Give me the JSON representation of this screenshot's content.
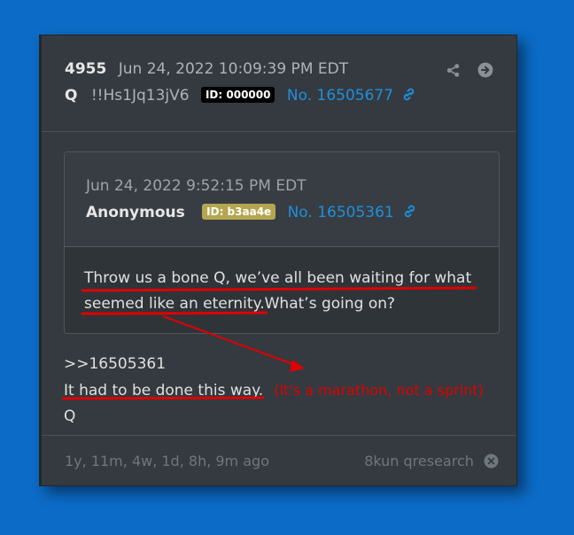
{
  "post": {
    "number": "4955",
    "date": "Jun 24, 2022 10:09:39 PM EDT",
    "author": "Q",
    "tripcode": "!!Hs1Jq13jV6",
    "id_badge": "ID: 000000",
    "post_no": "No. 16505677"
  },
  "quoted": {
    "date": "Jun 24, 2022 9:52:15 PM EDT",
    "author": "Anonymous",
    "id_badge": "ID: b3aa4e",
    "post_no": "No. 16505361",
    "body_line1": "Throw us a bone Q, we’ve all been waiting for what",
    "body_line2a": "seemed like an eternity.",
    "body_line2b": "What’s going on?"
  },
  "reply": {
    "ref": ">>16505361",
    "line": "It had to be done this way.",
    "annotation": "(It's a marathon, not a sprint)",
    "signature": "Q"
  },
  "footer": {
    "age": "1y, 11m, 4w, 1d, 8h, 9m ago",
    "source": "8kun qresearch"
  },
  "icons": {
    "share": "share-icon",
    "next": "arrow-right-circle-icon",
    "link": "link-icon",
    "close": "close-circle-icon"
  },
  "colors": {
    "background": "#0b6bc6",
    "card": "#343a40",
    "link": "#1f8fdb",
    "annotation": "#e00000",
    "id_badge_q": "#000000",
    "id_badge_anon": "#b4a650"
  }
}
